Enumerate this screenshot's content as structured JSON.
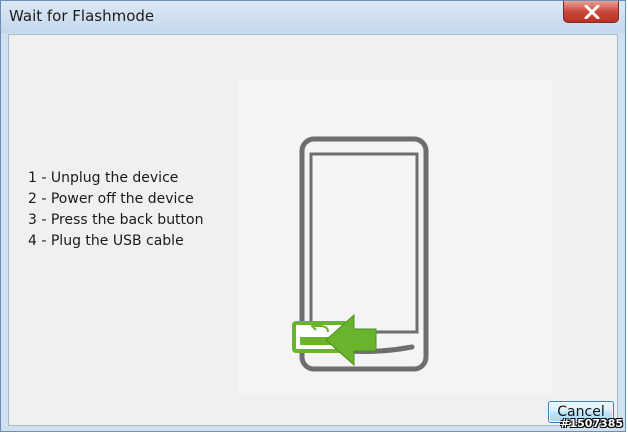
{
  "window": {
    "title": "Wait for Flashmode"
  },
  "instructions": [
    "1 - Unplug the device",
    "2 - Power off the device",
    "3 - Press the back button",
    "4 - Plug the USB cable"
  ],
  "buttons": {
    "cancel_label": "Cancel"
  },
  "watermark": "#1507385",
  "illustration": {
    "phone_icon": "phone-outline-icon",
    "back_button_icon": "back-arrow-icon",
    "pointer_icon": "green-arrow-left-icon"
  },
  "colors": {
    "accent_green": "#6ab42d",
    "phone_gray": "#6e6e6e",
    "close_red": "#c9483a"
  }
}
